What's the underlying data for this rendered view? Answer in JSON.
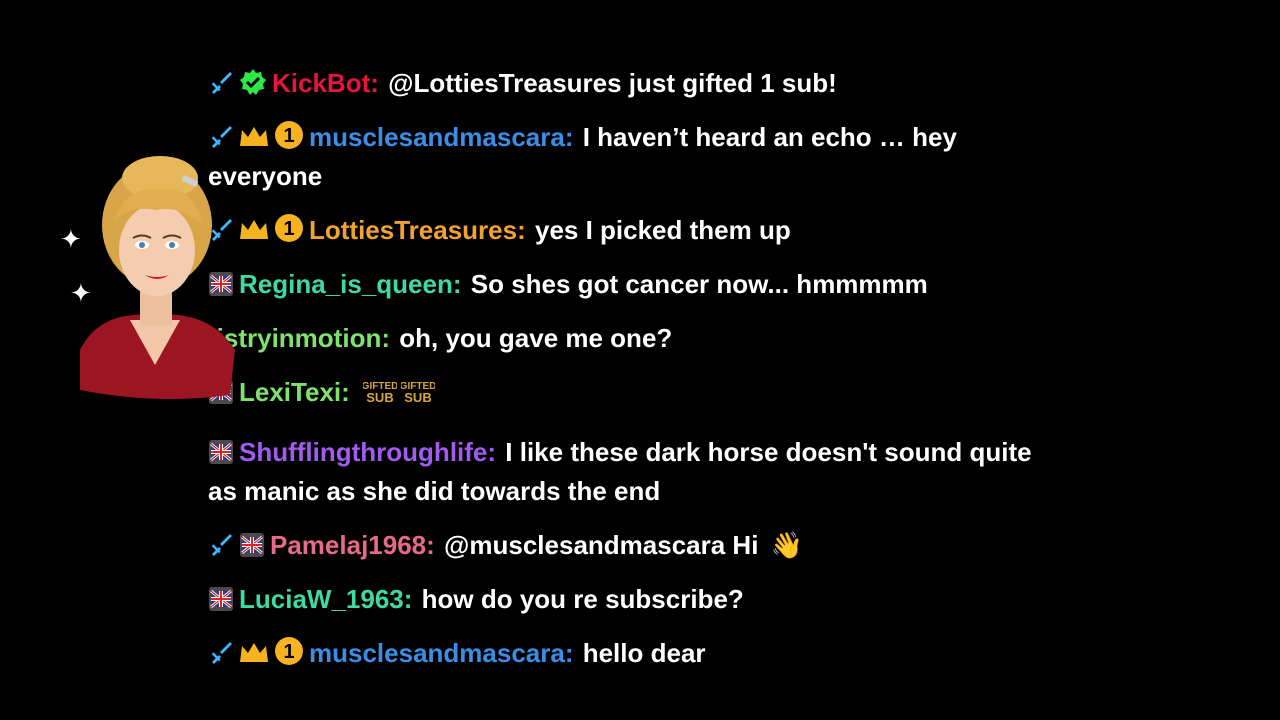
{
  "colors": {
    "background": "#000000",
    "message_text": "#ffffff"
  },
  "messages": [
    {
      "badges": [
        "sword-badge-icon",
        "verified-bot-badge-icon"
      ],
      "username": "KickBot:",
      "username_color": "#e8143c",
      "text": "@LottiesTreasures just gifted 1 sub!"
    },
    {
      "badges": [
        "sword-badge-icon",
        "crown-badge-icon",
        "subscriber-1-badge-icon"
      ],
      "username": "musclesandmascara:",
      "username_color": "#3a8ee6",
      "text": "I haven’t heard an echo … hey everyone"
    },
    {
      "badges": [
        "sword-badge-icon",
        "crown-badge-icon",
        "subscriber-1-badge-icon"
      ],
      "username": "LottiesTreasures:",
      "username_color": "#f2a233",
      "text": "yes I picked them up"
    },
    {
      "badges": [
        "uk-flag-badge-icon"
      ],
      "username": "Regina_is_queen:",
      "username_color": "#3ed9a6",
      "text": "So shes got cancer now... hmmmmm"
    },
    {
      "badges": [],
      "username": "tistryinmotion:",
      "username_color": "#7fe36b",
      "text": "oh, you gave me one?"
    },
    {
      "badges": [
        "uk-flag-badge-icon"
      ],
      "username": "LexiTexi:",
      "username_color": "#7fe36b",
      "text": "",
      "emotes": [
        "GIFTED SUB",
        "GIFTED SUB"
      ]
    },
    {
      "badges": [
        "uk-flag-badge-icon"
      ],
      "username": "Shufflingthroughlife:",
      "username_color": "#a25bf0",
      "text": "I like these dark horse doesn't sound quite as manic as she did towards the end"
    },
    {
      "badges": [
        "sword-badge-icon",
        "uk-flag-badge-icon"
      ],
      "username": "Pamelaj1968:",
      "username_color": "#e86a8a",
      "text": "@musclesandmascara Hi",
      "trailing_emoji": "👋"
    },
    {
      "badges": [
        "uk-flag-badge-icon"
      ],
      "username": "LuciaW_1963:",
      "username_color": "#3ed9a6",
      "text": "how do you re subscribe?"
    },
    {
      "badges": [
        "sword-badge-icon",
        "crown-badge-icon",
        "subscriber-1-badge-icon"
      ],
      "username": "musclesandmascara:",
      "username_color": "#3a8ee6",
      "text": "hello dear"
    }
  ]
}
